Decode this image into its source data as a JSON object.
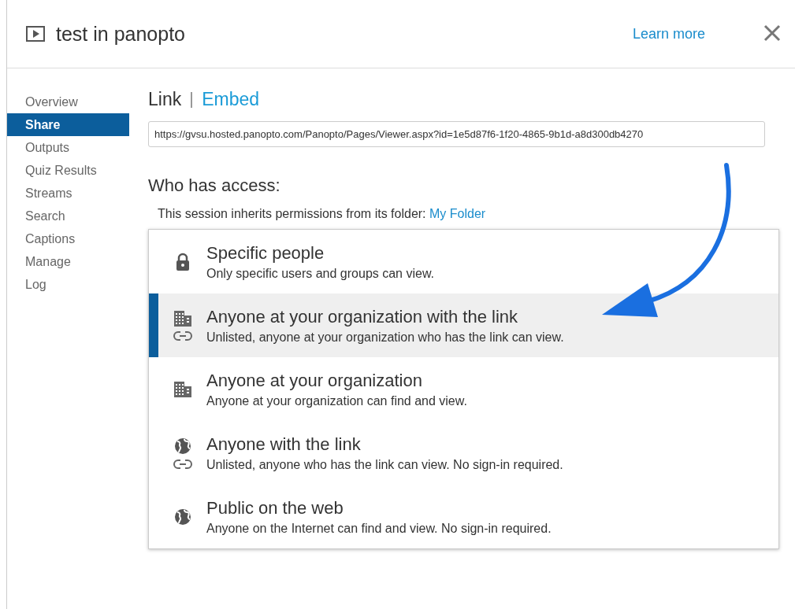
{
  "window": {
    "title": "test in panopto",
    "learn_more": "Learn more"
  },
  "sidebar": {
    "items": [
      {
        "label": "Overview",
        "selected": false
      },
      {
        "label": "Share",
        "selected": true
      },
      {
        "label": "Outputs",
        "selected": false
      },
      {
        "label": "Quiz Results",
        "selected": false
      },
      {
        "label": "Streams",
        "selected": false
      },
      {
        "label": "Search",
        "selected": false
      },
      {
        "label": "Captions",
        "selected": false
      },
      {
        "label": "Manage",
        "selected": false
      },
      {
        "label": "Log",
        "selected": false
      }
    ]
  },
  "tabs": [
    {
      "label": "Link",
      "selected": true
    },
    {
      "label": "Embed",
      "selected": false
    }
  ],
  "link_field": {
    "value": "https://gvsu.hosted.panopto.com/Panopto/Pages/Viewer.aspx?id=1e5d87f6-1f20-4865-9b1d-a8d300db4270"
  },
  "access": {
    "heading": "Who has access:",
    "inherit_text": "This session inherits permissions from its folder:",
    "folder_link": "My Folder",
    "options": [
      {
        "title": "Specific people",
        "description": "Only specific users and groups can view.",
        "icons": [
          {
            "kind": "lock"
          }
        ],
        "selected": false
      },
      {
        "title": "Anyone at your organization with the link",
        "description": "Unlisted, anyone at your organization who has the link can view.",
        "icons": [
          {
            "kind": "building"
          },
          {
            "kind": "link"
          }
        ],
        "selected": true
      },
      {
        "title": "Anyone at your organization",
        "description": "Anyone at your organization can find and view.",
        "icons": [
          {
            "kind": "building"
          }
        ],
        "selected": false
      },
      {
        "title": "Anyone with the link",
        "description": "Unlisted, anyone who has the link can view. No sign-in required.",
        "icons": [
          {
            "kind": "globe"
          },
          {
            "kind": "link"
          }
        ],
        "selected": false
      },
      {
        "title": "Public on the web",
        "description": "Anyone on the Internet can find and view. No sign-in required.",
        "icons": [
          {
            "kind": "globe"
          }
        ],
        "selected": false
      }
    ]
  }
}
